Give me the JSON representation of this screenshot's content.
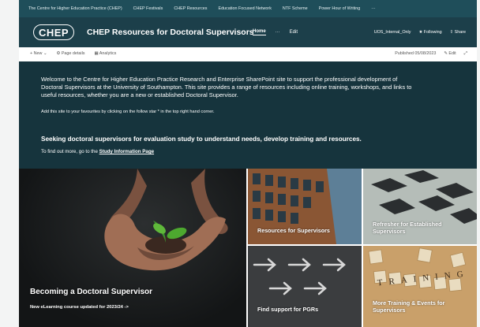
{
  "hub_nav": {
    "items": [
      "The Centre for Higher Education Practice (CHEP)",
      "CHEP Festivals",
      "CHEP Resources",
      "Education Focused Network",
      "NTF Scheme",
      "Power Hour of Writing",
      "···"
    ]
  },
  "site_header": {
    "logo_text": "CHEP",
    "title": "CHEP Resources for Doctoral Supervisors",
    "nav": {
      "home": "Home",
      "more": "···",
      "edit": "Edit"
    },
    "label_badge": "UOS_Internal_Only",
    "following": "Following",
    "share": "Share"
  },
  "command_bar": {
    "new": "New",
    "page_details": "Page details",
    "analytics": "Analytics",
    "published": "Published 05/08/2023",
    "edit": "Edit"
  },
  "intro": {
    "welcome": "Welcome to the Centre for Higher Education Practice Research and Enterprise SharePoint site to support the professional development of Doctoral Supervisors at the University of Southampton. This site provides a range of resources including online training, workshops, and links to useful resources, whether you are a new or established Doctoral Supervisor.",
    "favourites_note": "Add this site to your favourites by clicking on the follow star * in the top right hand corner.",
    "seeking": "Seeking doctoral supervisors for evaluation study to understand needs, develop training and resources.",
    "find_out_prefix": "To find out more, go to the",
    "find_out_link": "Study Information Page"
  },
  "tiles": {
    "hero_title": "Becoming a Doctoral Supervisor",
    "hero_sub": "New eLearning course updated for 2023/24 ->",
    "resources": "Resources for Supervisors",
    "refresher": "Refresher for Established Supervisors",
    "find_support": "Find support for PGRs",
    "more_training": "More Training & Events for Supervisors",
    "training_word": "TRAINING"
  },
  "colors": {
    "hub_nav": "#1f4e5a",
    "site_header": "#1c3f4a",
    "intro_band": "#16343d"
  }
}
